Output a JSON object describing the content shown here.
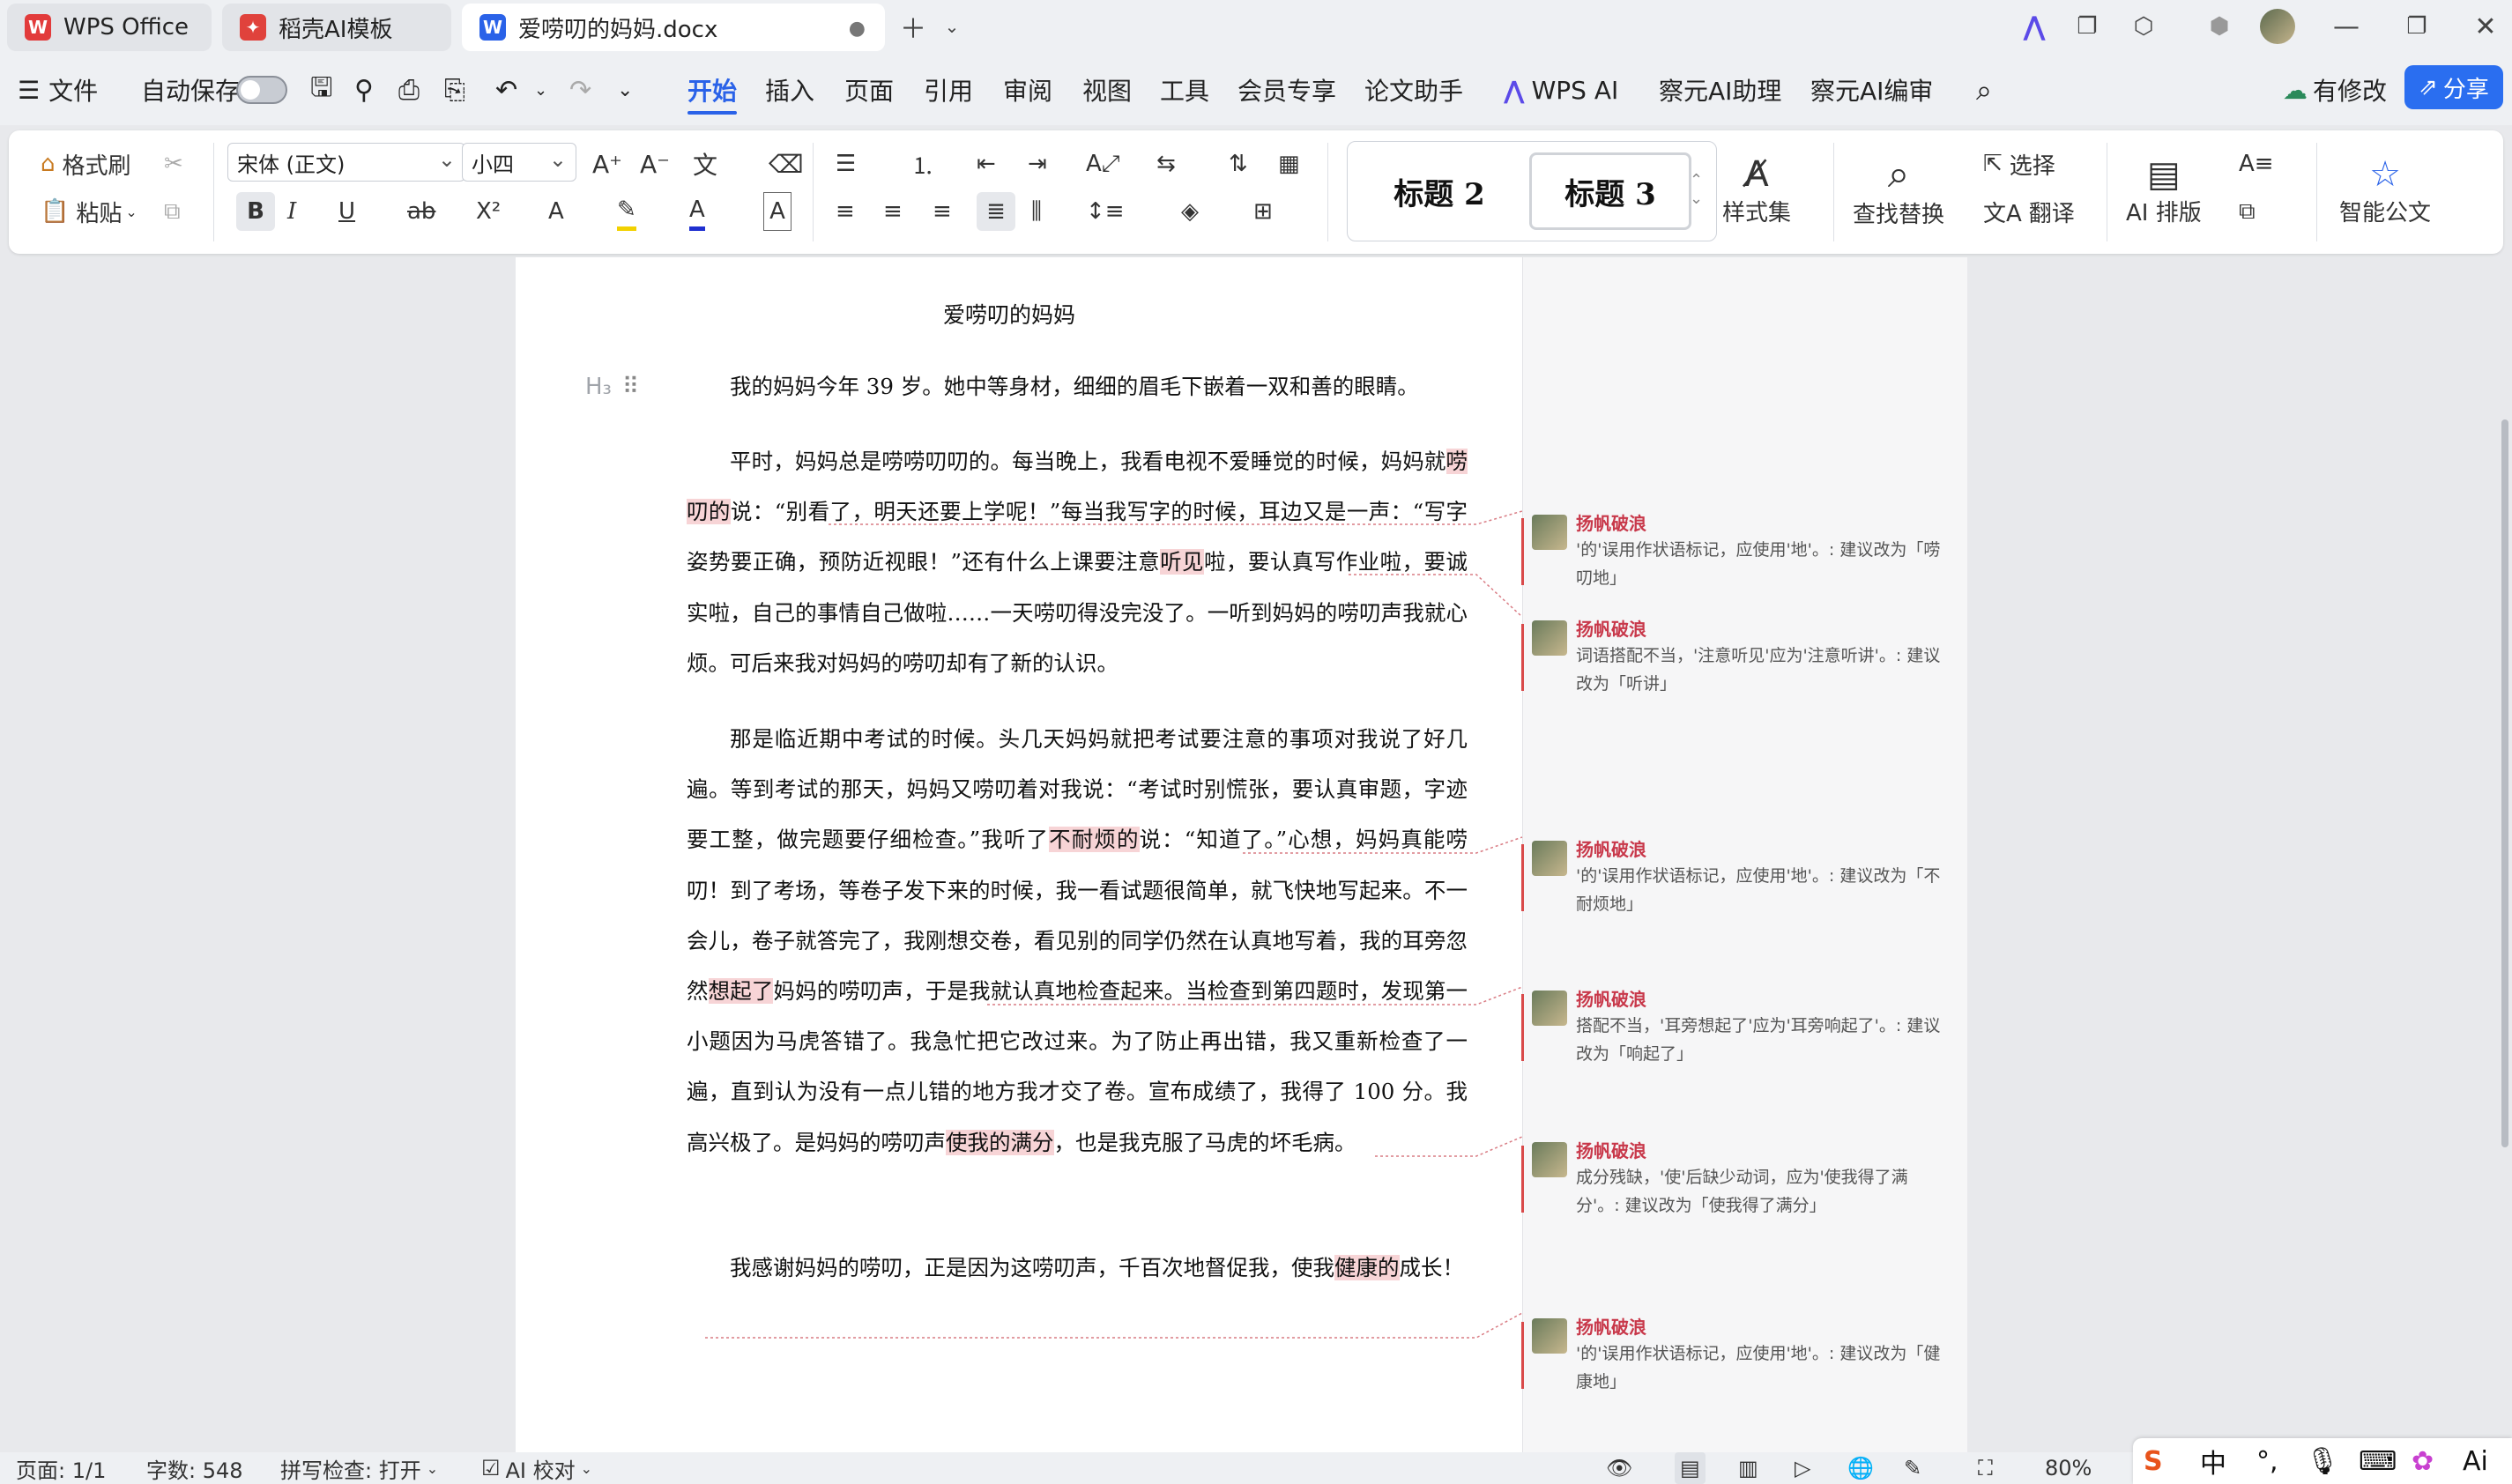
{
  "tabs": [
    {
      "label": "WPS Office",
      "icon": "wps-logo-icon"
    },
    {
      "label": "稻壳AI模板",
      "icon": "docer-logo-icon"
    },
    {
      "label": "爱唠叨的妈妈.docx",
      "icon": "word-doc-icon",
      "active": true
    }
  ],
  "menu": {
    "file": "文件",
    "autosave": "自动保存",
    "autosave_on": false,
    "tabs": [
      "开始",
      "插入",
      "页面",
      "引用",
      "审阅",
      "视图",
      "工具",
      "会员专享",
      "论文助手",
      "WPS AI",
      "察元AI助理",
      "察元AI编审"
    ],
    "active_tab": "开始",
    "modified": "有修改",
    "share": "分享"
  },
  "ribbon": {
    "format_painter": "格式刷",
    "paste": "粘贴",
    "font_name": "宋体 (正文)",
    "font_size": "小四",
    "style_h2": "标题 2",
    "style_h3": "标题 3",
    "style_set": "样式集",
    "find_replace": "查找替换",
    "select": "选择",
    "translate": "翻译",
    "ai_layout": "AI 排版",
    "smart_doc": "智能公文"
  },
  "document": {
    "title": "爱唠叨的妈妈",
    "paragraphs": [
      [
        {
          "t": "我的妈妈今年 39 岁。她中等身材，细细的眉毛下嵌着一双和善的眼睛。"
        }
      ],
      [
        {
          "t": "平时，妈妈总是唠唠叨叨的。每当晚上，我看电视不爱睡觉的时候，妈妈就"
        },
        {
          "t": "唠叨的",
          "hl": true
        },
        {
          "t": "说：“别看了，明天还要上学呢！”每当我写字的时候，耳边又是一声：“写字姿势要正确，预防近视眼！”还有什么上课要注意"
        },
        {
          "t": "听见",
          "hl": true
        },
        {
          "t": "啦，要认真写作业啦，要诚实啦，自己的事情自己做啦……一天唠叨得没完没了。一听到妈妈的唠叨声我就心烦。可后来我对妈妈的唠叨却有了新的认识。"
        }
      ],
      [
        {
          "t": "那是临近期中考试的时候。头几天妈妈就把考试要注意的事项对我说了好几遍。等到考试的那天，妈妈又唠叨着对我说：“考试时别慌张，要认真审题，字迹要工整，做完题要仔细检查。”我听了"
        },
        {
          "t": "不耐烦的",
          "hl": true
        },
        {
          "t": "说：“知道了。”心想，妈妈真能唠叨！到了考场，等卷子发下来的时候，我一看试题很简单，就飞快地写起来。不一会儿，卷子就答完了，我刚想交卷，看见别的同学仍然在认真地写着，我的耳旁忽然"
        },
        {
          "t": "想起了",
          "hl": true
        },
        {
          "t": "妈妈的唠叨声，于是我就认真地检查起来。当检查到第四题时，发现第一小题因为马虎答错了。我急忙把它改过来。为了防止再出错，我又重新检查了一遍，直到认为没有一点儿错的地方我才交了卷。宣布成绩了，我得了 100 分。我高兴极了。是妈妈的唠叨声"
        },
        {
          "t": "使我的满分",
          "hl": true
        },
        {
          "t": "，也是我克服了马虎的坏毛病。"
        }
      ],
      [
        {
          "t": "我感谢妈妈的唠叨，正是因为这唠叨声，千百次地督促我，使我"
        },
        {
          "t": "健康的",
          "hl": true
        },
        {
          "t": "成长！"
        }
      ]
    ]
  },
  "comments": [
    {
      "author": "扬帆破浪",
      "text": "'的'误用作状语标记，应使用'地'。: 建议改为「唠叨地」"
    },
    {
      "author": "扬帆破浪",
      "text": "词语搭配不当，'注意听见'应为'注意听讲'。: 建议改为「听讲」"
    },
    {
      "author": "扬帆破浪",
      "text": "'的'误用作状语标记，应使用'地'。: 建议改为「不耐烦地」"
    },
    {
      "author": "扬帆破浪",
      "text": "搭配不当，'耳旁想起了'应为'耳旁响起了'。: 建议改为「响起了」"
    },
    {
      "author": "扬帆破浪",
      "text": "成分残缺，'使'后缺少动词，应为'使我得了满分'。: 建议改为「使我得了满分」"
    },
    {
      "author": "扬帆破浪",
      "text": "'的'误用作状语标记，应使用'地'。: 建议改为「健康地」"
    }
  ],
  "status": {
    "page": "页面: 1/1",
    "words": "字数: 548",
    "spell": "拼写检查: 打开",
    "ai_check": "AI 校对",
    "zoom": "80%"
  },
  "ime": {
    "lang": "中",
    "punct": "°,"
  }
}
